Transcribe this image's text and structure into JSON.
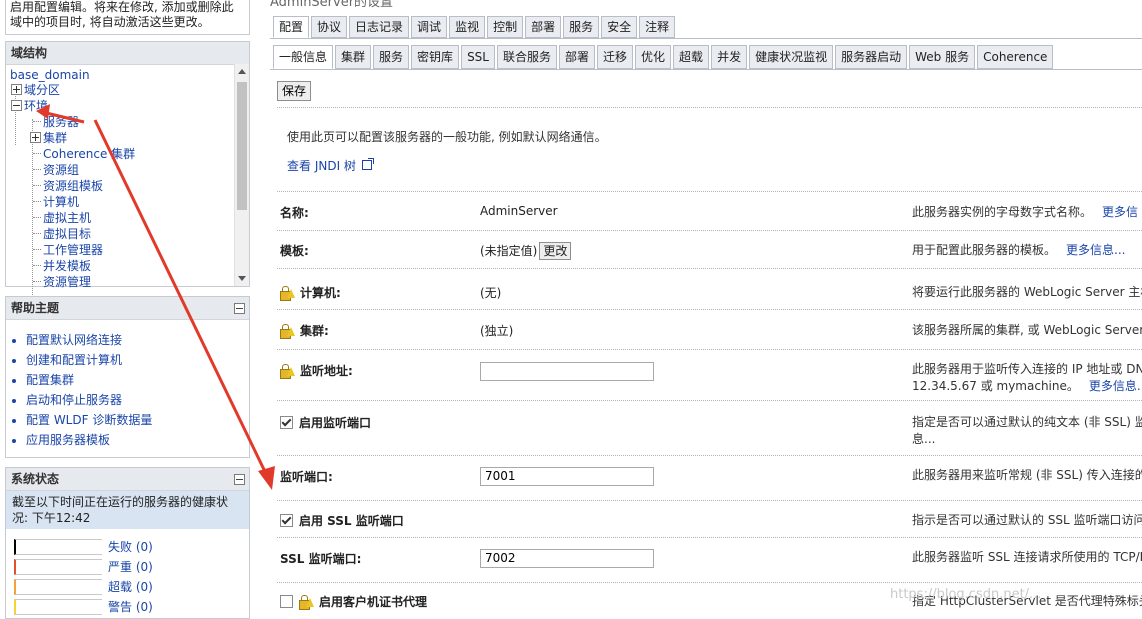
{
  "top_message": {
    "line1": "启用配置编辑。将来在修改, 添加或删除此",
    "line2": "域中的项目时, 将自动激活这些更改。"
  },
  "domain_structure": {
    "title": "域结构",
    "root": "base_domain",
    "items": [
      {
        "label": "域分区",
        "expander": "plus"
      },
      {
        "label": "环境",
        "expander": "minus"
      },
      {
        "label": "服务器"
      },
      {
        "label": "集群",
        "expander": "plus"
      },
      {
        "label": "Coherence 集群"
      },
      {
        "label": "资源组"
      },
      {
        "label": "资源组模板"
      },
      {
        "label": "计算机"
      },
      {
        "label": "虚拟主机"
      },
      {
        "label": "虚拟目标"
      },
      {
        "label": "工作管理器"
      },
      {
        "label": "并发模板"
      },
      {
        "label": "资源管理"
      }
    ]
  },
  "help_topics": {
    "title": "帮助主题",
    "items": [
      "配置默认网络连接",
      "创建和配置计算机",
      "配置集群",
      "启动和停止服务器",
      "配置 WLDF 诊断数据量",
      "应用服务器模板"
    ]
  },
  "system_status": {
    "title": "系统状态",
    "message": "截至以下时间正在运行的服务器的健康状况: 下午12:42",
    "rows": [
      {
        "label": "失败 (0)",
        "color": "#000000"
      },
      {
        "label": "严重 (0)",
        "color": "#e3502b"
      },
      {
        "label": "超载 (0)",
        "color": "#f2a33a"
      },
      {
        "label": "警告 (0)",
        "color": "#f5d43a"
      }
    ]
  },
  "main": {
    "header_cut": "AdminServer的设置",
    "tabs": [
      "配置",
      "协议",
      "日志记录",
      "调试",
      "监视",
      "控制",
      "部署",
      "服务",
      "安全",
      "注释"
    ],
    "subtabs": [
      "一般信息",
      "集群",
      "服务",
      "密钥库",
      "SSL",
      "联合服务",
      "部署",
      "迁移",
      "优化",
      "超载",
      "并发",
      "健康状况监视",
      "服务器启动",
      "Web 服务",
      "Coherence"
    ],
    "save_label": "保存",
    "description": "使用此页可以配置该服务器的一般功能, 例如默认网络通信。",
    "jndi_link": "查看 JNDI 树",
    "fields": {
      "name": {
        "label": "名称:",
        "value": "AdminServer",
        "help": "此服务器实例的字母数字式名称。",
        "more": "更多信"
      },
      "template": {
        "label": "模板:",
        "value": "(未指定值)",
        "button": "更改",
        "help": "用于配置此服务器的模板。",
        "more": "更多信息..."
      },
      "machine": {
        "label": "计算机:",
        "value": "(无)",
        "help": "将要运行此服务器的 WebLogic Server 主机"
      },
      "cluster": {
        "label": "集群:",
        "value": "(独立)",
        "help": "该服务器所属的集群, 或 WebLogic Server 实"
      },
      "listen_address": {
        "label": "监听地址:",
        "value": "",
        "help1": "此服务器用于监听传入连接的 IP 地址或 DN",
        "help2": "12.34.5.67 或 mymachine。",
        "more": "更多信息..."
      },
      "listen_port_enabled": {
        "label": "启用监听端口",
        "help1": "指定是否可以通过默认的纯文本 (非 SSL) 监",
        "help2": "息..."
      },
      "listen_port": {
        "label": "监听端口:",
        "value": "7001",
        "help": "此服务器用来监听常规 (非 SSL) 传入连接的"
      },
      "ssl_enabled": {
        "label": "启用 SSL 监听端口",
        "help": "指示是否可以通过默认的 SSL 监听端口访问"
      },
      "ssl_port": {
        "label": "SSL 监听端口:",
        "value": "7002",
        "help": "此服务器监听 SSL 连接请求所使用的 TCP/IP"
      },
      "client_cert_proxy": {
        "label": "启用客户机证书代理",
        "help": "指定 HttpClusterServlet 是否代理特殊标头中"
      }
    }
  },
  "watermark": "https://blog.csdn.net/..."
}
